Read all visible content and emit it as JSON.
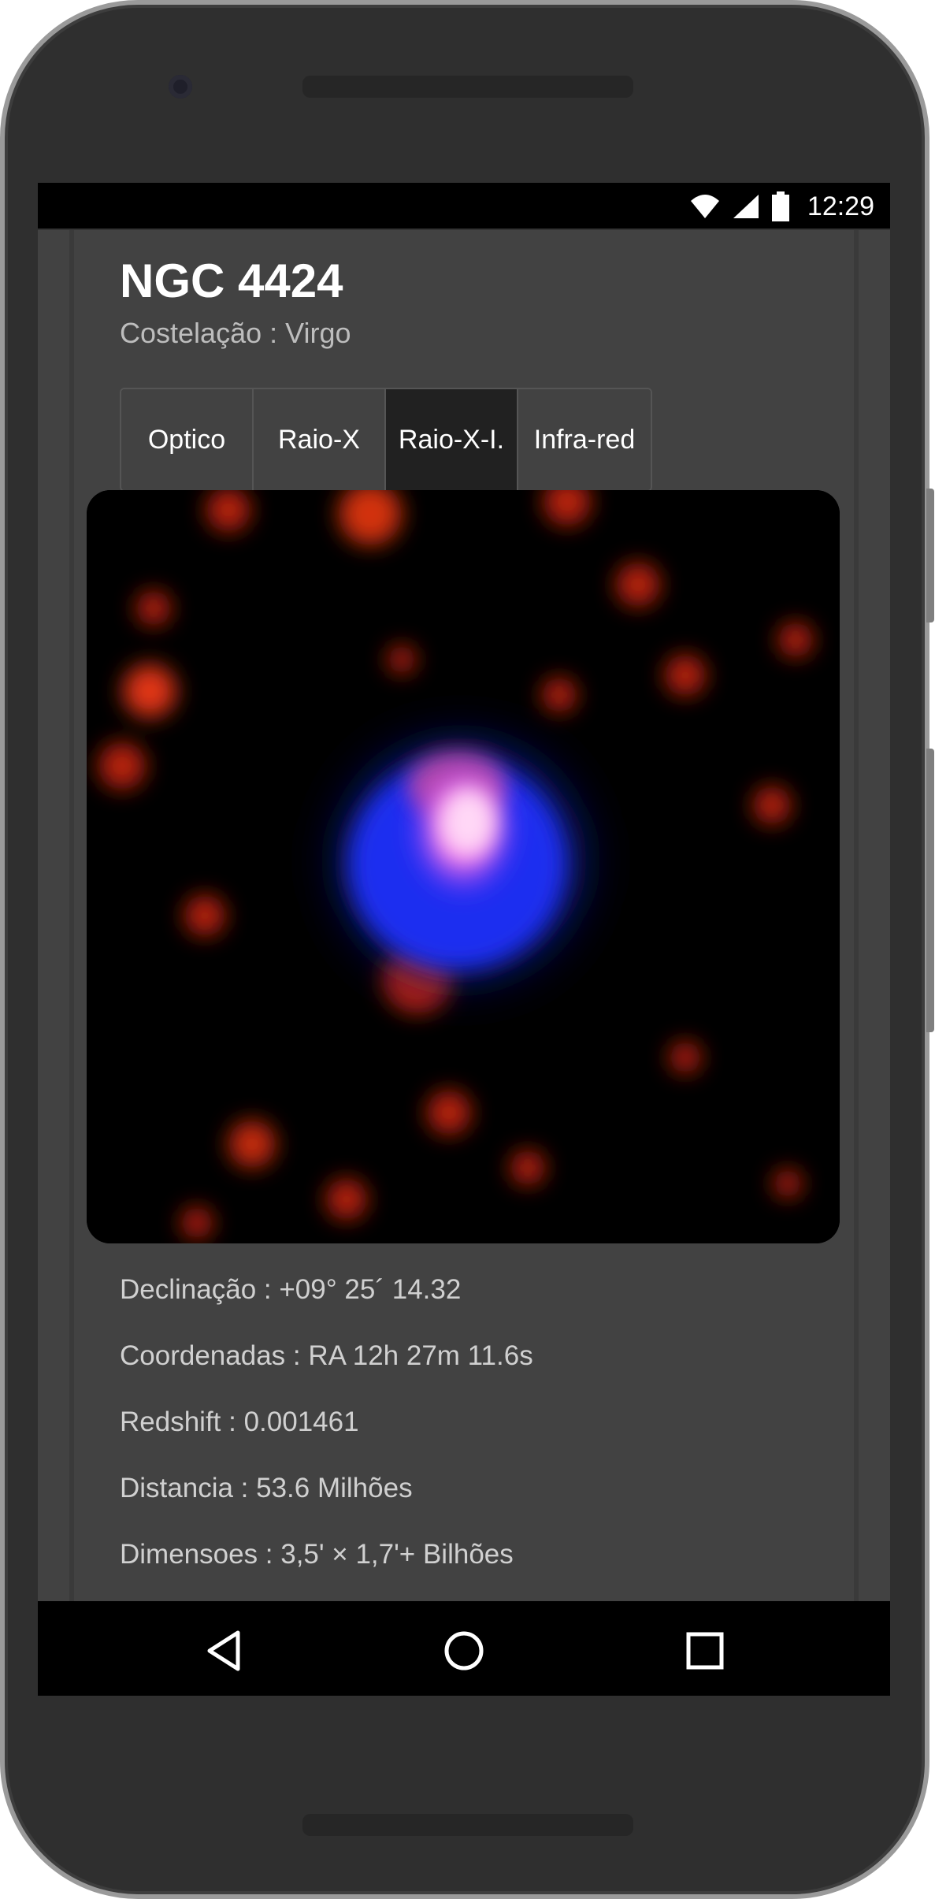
{
  "statusbar": {
    "time": "12:29",
    "icons": [
      "wifi-icon",
      "signal-icon",
      "battery-icon"
    ]
  },
  "object": {
    "name": "NGC 4424",
    "constellation": "Costelação : Virgo"
  },
  "tabs": [
    {
      "label": "Optico",
      "active": false
    },
    {
      "label": "Raio-X",
      "active": false
    },
    {
      "label": "Raio-X-I.",
      "active": true
    },
    {
      "label": "Infra-red",
      "active": false
    }
  ],
  "image": {
    "description_icon": "galaxy-image"
  },
  "info": {
    "declination": "Declinação : +09° 25´ 14.32",
    "coordinates": "Coordenadas : RA 12h 27m 11.6s",
    "redshift": "Redshift : 0.001461",
    "distance": "Distancia : 53.6 Milhões",
    "dimensions": "Dimensoes : 3,5' × 1,7'+ Bilhões"
  },
  "navbar": {
    "icons": [
      "back-icon",
      "home-icon",
      "recents-icon"
    ]
  },
  "colors": {
    "content_bg": "#424242",
    "active_tab": "#212121",
    "accent_blue": "#1f4bff",
    "accent_red": "#c0200a"
  }
}
